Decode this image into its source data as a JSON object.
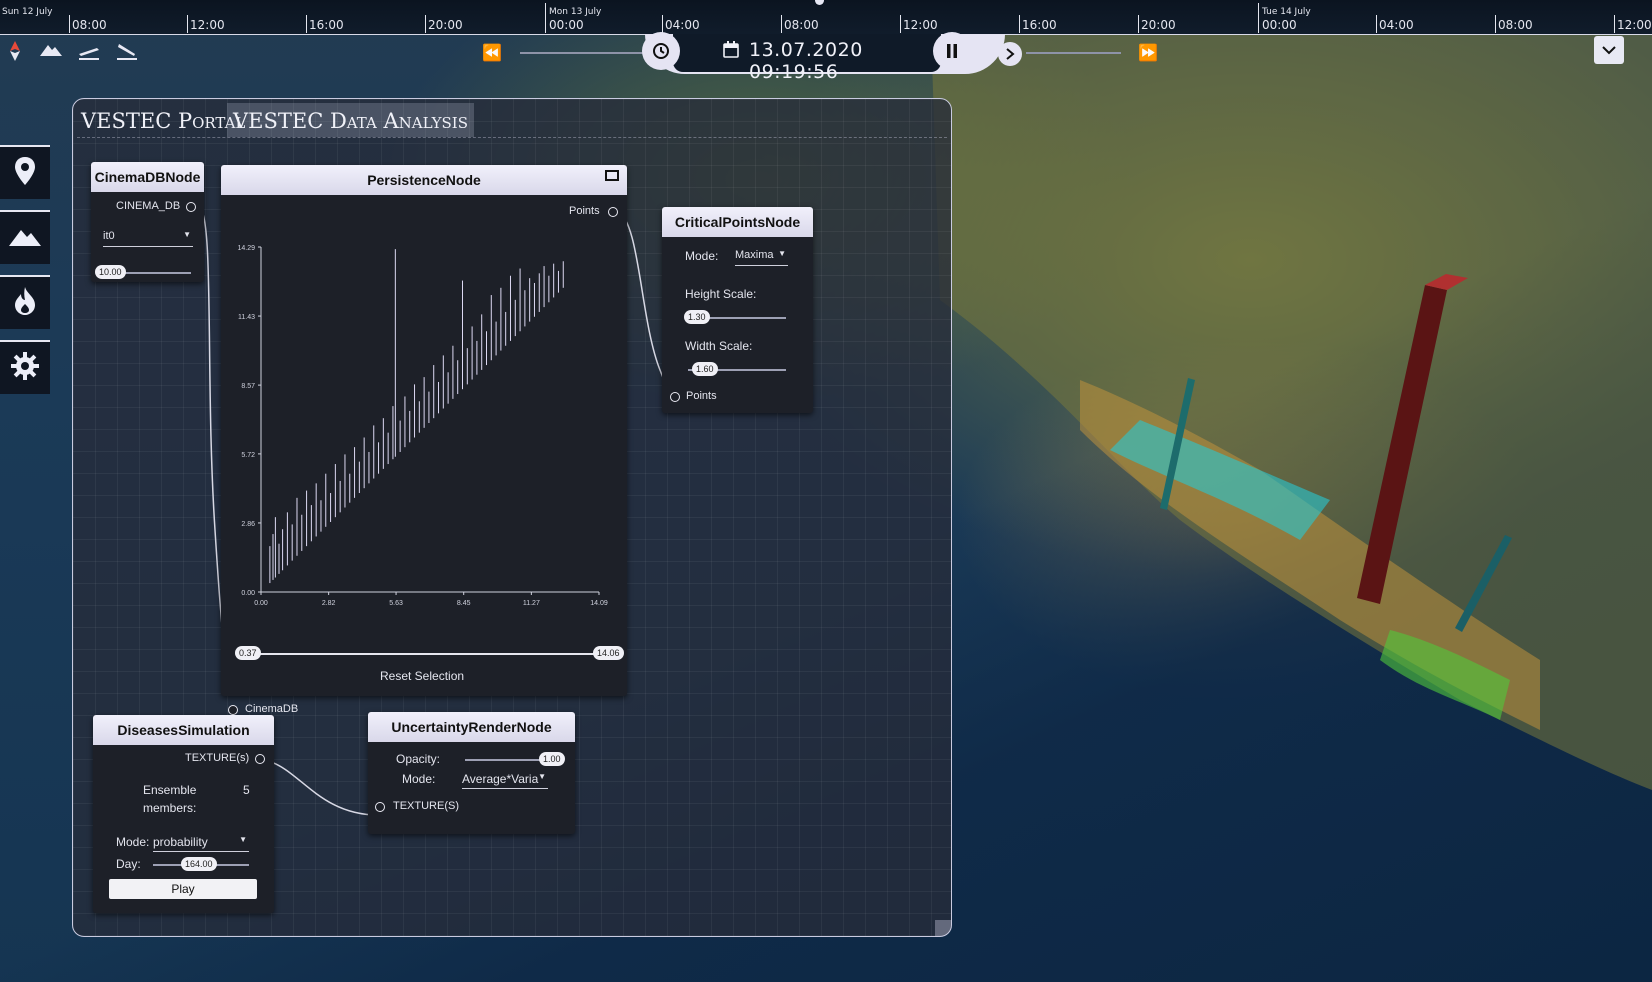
{
  "timeline": {
    "days": [
      {
        "label": "Sun 12 July"
      },
      {
        "label": "Mon 13 July"
      },
      {
        "label": "Tue 14 July"
      }
    ],
    "times": [
      "08:00",
      "12:00",
      "16:00",
      "20:00",
      "00:00",
      "04:00",
      "08:00",
      "12:00",
      "16:00",
      "20:00",
      "00:00",
      "04:00",
      "08:00",
      "12:00"
    ]
  },
  "toolbar": {
    "icons": [
      "compass-icon",
      "mountain-icon",
      "departure-icon",
      "arrival-icon"
    ],
    "rewind": "⏪",
    "fast_forward": "⏩",
    "datetime": "13.07.2020 09:19:56"
  },
  "sidebar": {
    "items": [
      "location-pin-icon",
      "mountain-icon",
      "fire-icon",
      "gear-icon"
    ]
  },
  "panel": {
    "title_portal": "VESTEC Portal",
    "title_analysis": "VESTEC Data Analysis"
  },
  "nodes": {
    "cinema": {
      "title": "CinemaDBNode",
      "output": "CINEMA_DB",
      "select_value": "it0",
      "slider_value": "10.00"
    },
    "persistence": {
      "title": "PersistenceNode",
      "output": "Points",
      "input": "CinemaDB",
      "range_min": "0.37",
      "range_max": "14.06",
      "reset_label": "Reset Selection"
    },
    "critical": {
      "title": "CriticalPointsNode",
      "mode_label": "Mode:",
      "mode_value": "Maxima",
      "height_label": "Height Scale:",
      "height_value": "1.30",
      "width_label": "Width Scale:",
      "width_value": "1.60",
      "input": "Points"
    },
    "disease": {
      "title": "DiseasesSimulation",
      "output": "TEXTURE(s)",
      "ensemble_label_1": "Ensemble",
      "ensemble_label_2": "members:",
      "ensemble_value": "5",
      "mode_label": "Mode:",
      "mode_value": "probability",
      "day_label": "Day:",
      "day_value": "164.00",
      "play_label": "Play"
    },
    "uncertainty": {
      "title": "UncertaintyRenderNode",
      "opacity_label": "Opacity:",
      "opacity_value": "1.00",
      "mode_label": "Mode:",
      "mode_value": "Average*Varia",
      "input": "TEXTURE(S)"
    }
  },
  "chart_data": {
    "type": "scatter",
    "title": "",
    "xlabel": "",
    "ylabel": "",
    "xlim": [
      0.0,
      14.09
    ],
    "ylim": [
      0.0,
      14.29
    ],
    "x_ticks": [
      "0.00",
      "2.82",
      "5.63",
      "8.45",
      "11.27",
      "14.09"
    ],
    "y_ticks": [
      "0.00",
      "2.86",
      "5.72",
      "8.57",
      "11.43",
      "14.29"
    ],
    "description_of_marks": "persistence pairs drawn as vertical segments from the diagonal y=x up to the death value",
    "pairs": [
      [
        0.37,
        1.9
      ],
      [
        0.5,
        2.4
      ],
      [
        0.6,
        3.1
      ],
      [
        0.75,
        2.0
      ],
      [
        0.9,
        2.6
      ],
      [
        1.1,
        3.3
      ],
      [
        1.3,
        2.8
      ],
      [
        1.5,
        3.9
      ],
      [
        1.7,
        3.2
      ],
      [
        1.9,
        4.2
      ],
      [
        2.1,
        3.6
      ],
      [
        2.3,
        4.5
      ],
      [
        2.5,
        3.8
      ],
      [
        2.7,
        4.9
      ],
      [
        2.9,
        4.1
      ],
      [
        3.1,
        5.3
      ],
      [
        3.3,
        4.6
      ],
      [
        3.5,
        5.7
      ],
      [
        3.7,
        4.9
      ],
      [
        3.9,
        6.0
      ],
      [
        4.1,
        5.4
      ],
      [
        4.3,
        6.4
      ],
      [
        4.5,
        5.8
      ],
      [
        4.7,
        6.9
      ],
      [
        4.9,
        6.2
      ],
      [
        5.1,
        7.2
      ],
      [
        5.3,
        6.6
      ],
      [
        5.5,
        7.7
      ],
      [
        5.6,
        14.2
      ],
      [
        5.8,
        7.1
      ],
      [
        6.0,
        8.1
      ],
      [
        6.2,
        7.5
      ],
      [
        6.4,
        8.6
      ],
      [
        6.6,
        7.9
      ],
      [
        6.8,
        8.9
      ],
      [
        7.0,
        8.3
      ],
      [
        7.2,
        9.4
      ],
      [
        7.4,
        8.7
      ],
      [
        7.6,
        9.8
      ],
      [
        7.8,
        9.1
      ],
      [
        8.0,
        10.2
      ],
      [
        8.2,
        9.6
      ],
      [
        8.4,
        12.9
      ],
      [
        8.6,
        10.1
      ],
      [
        8.8,
        11.0
      ],
      [
        9.0,
        10.4
      ],
      [
        9.2,
        11.5
      ],
      [
        9.4,
        10.8
      ],
      [
        9.6,
        12.3
      ],
      [
        9.8,
        11.2
      ],
      [
        10.0,
        12.6
      ],
      [
        10.2,
        11.6
      ],
      [
        10.4,
        13.1
      ],
      [
        10.6,
        12.1
      ],
      [
        10.8,
        13.4
      ],
      [
        11.0,
        12.5
      ],
      [
        11.2,
        13.0
      ],
      [
        11.4,
        12.8
      ],
      [
        11.6,
        13.2
      ],
      [
        11.8,
        13.5
      ],
      [
        12.0,
        13.1
      ],
      [
        12.2,
        13.6
      ],
      [
        12.4,
        13.3
      ],
      [
        12.6,
        13.7
      ]
    ]
  }
}
